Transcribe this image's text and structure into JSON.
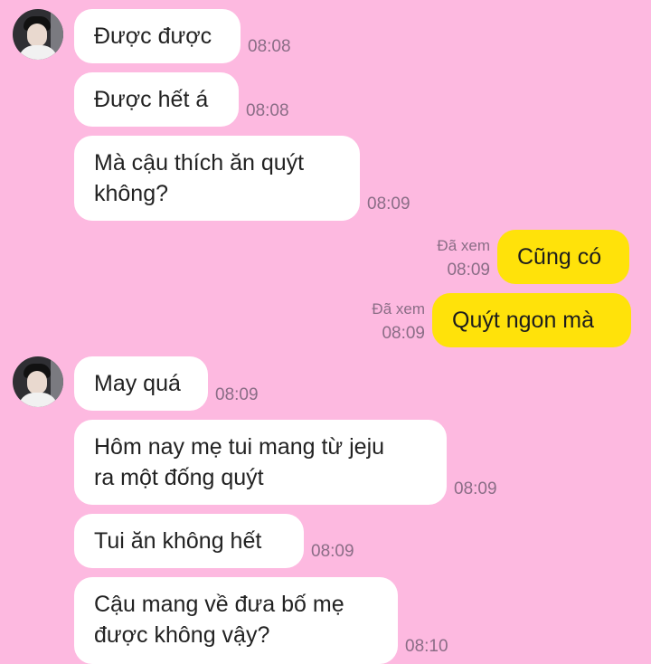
{
  "messages": [
    {
      "text": "Được được",
      "time": "08:08",
      "from": "them",
      "avatar": true
    },
    {
      "text": "Được hết á",
      "time": "08:08",
      "from": "them"
    },
    {
      "text": "Mà cậu thích ăn quýt\nkhông?",
      "time": "08:09",
      "from": "them"
    },
    {
      "text": "Cũng có",
      "time": "08:09",
      "from": "me",
      "status": "Đã xem"
    },
    {
      "text": "Quýt ngon mà",
      "time": "08:09",
      "from": "me",
      "status": "Đã xem"
    },
    {
      "text": "May quá",
      "time": "08:09",
      "from": "them",
      "avatar": true
    },
    {
      "text": "Hôm nay mẹ tui mang từ jeju\nra một đống quýt",
      "time": "08:09",
      "from": "them"
    },
    {
      "text": "Tui ăn không hết",
      "time": "08:09",
      "from": "them"
    },
    {
      "text": "Cậu mang về đưa bố mẹ\nđược không vậy?",
      "time": "08:10",
      "from": "them"
    }
  ],
  "colors": {
    "background": "#fdb9e0",
    "incoming": "#ffffff",
    "outgoing": "#ffe20a",
    "meta": "#8a6d86"
  },
  "icons": {
    "avatar": "user-avatar-photo"
  }
}
